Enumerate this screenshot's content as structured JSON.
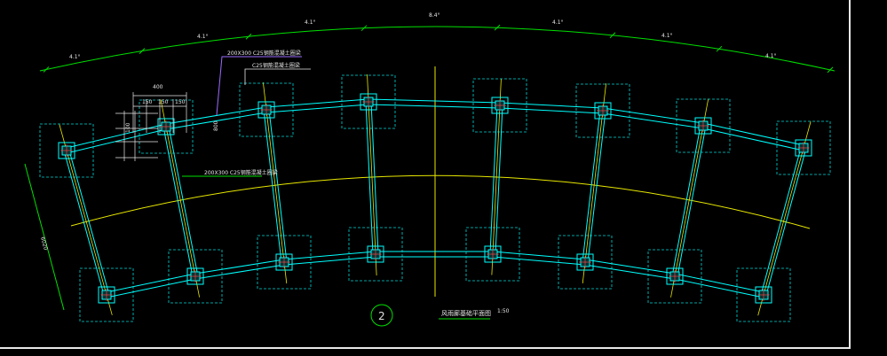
{
  "drawing": {
    "top_dimensions": [
      "4.1°",
      "4.1°",
      "4.1°",
      "8.4°",
      "4.1°",
      "4.1°",
      "4.1°"
    ],
    "left_dimension": "6020",
    "detail_dims": [
      "400",
      "150",
      "150",
      "150",
      "100"
    ],
    "annotation_1": "200X300 C25钢筋混凝土圈梁",
    "annotation_2": "C25钢筋混凝土圈梁",
    "annotation_3": "200X300 C25钢筋混凝土圈梁",
    "side_mark": "800",
    "section_number": "2",
    "title": "风雨廊基础平面图",
    "scale": "1:50"
  },
  "colors": {
    "background": "#000000",
    "beam": "#00ffff",
    "footing": "#00d8d8",
    "axis": "#e8e800",
    "dimension": "#00e000",
    "annotation_line": "#9b6bff"
  }
}
